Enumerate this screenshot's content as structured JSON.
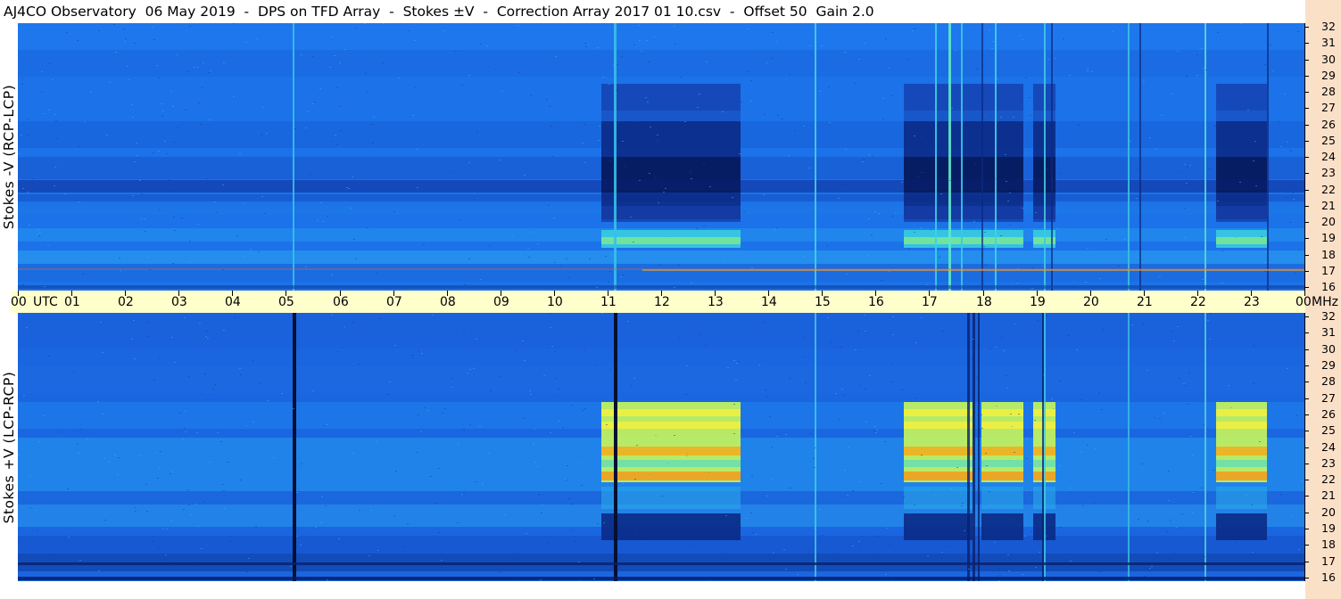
{
  "title": "AJ4CO Observatory  06 May 2019  -  DPS on TFD Array  -  Stokes ±V  -  Correction Array 2017 01 10.csv  -  Offset 50  Gain 2.0",
  "panels": {
    "top": {
      "label": "Stokes -V (RCP-LCP)"
    },
    "bottom": {
      "label": "Stokes +V (LCP-RCP)"
    }
  },
  "time_axis": {
    "labels": [
      "00",
      "01",
      "02",
      "03",
      "04",
      "05",
      "06",
      "07",
      "08",
      "09",
      "10",
      "11",
      "12",
      "13",
      "14",
      "15",
      "16",
      "17",
      "18",
      "19",
      "20",
      "21",
      "22",
      "23",
      "00"
    ],
    "utc_label": "UTC",
    "unit_label": "MHz"
  },
  "freq_axis": {
    "labels": [
      "32",
      "31",
      "30",
      "29",
      "28",
      "27",
      "26",
      "25",
      "24",
      "23",
      "22",
      "21",
      "20",
      "19",
      "18",
      "17",
      "16"
    ]
  },
  "colors": {
    "background_blue": "#1a6ee6",
    "dark_blue": "#0a1f6b",
    "yellow": "#f5f542",
    "orange_band": "#f0a020",
    "time_bar": "#ffffcc",
    "side_strip": "#fbe0c8"
  }
}
